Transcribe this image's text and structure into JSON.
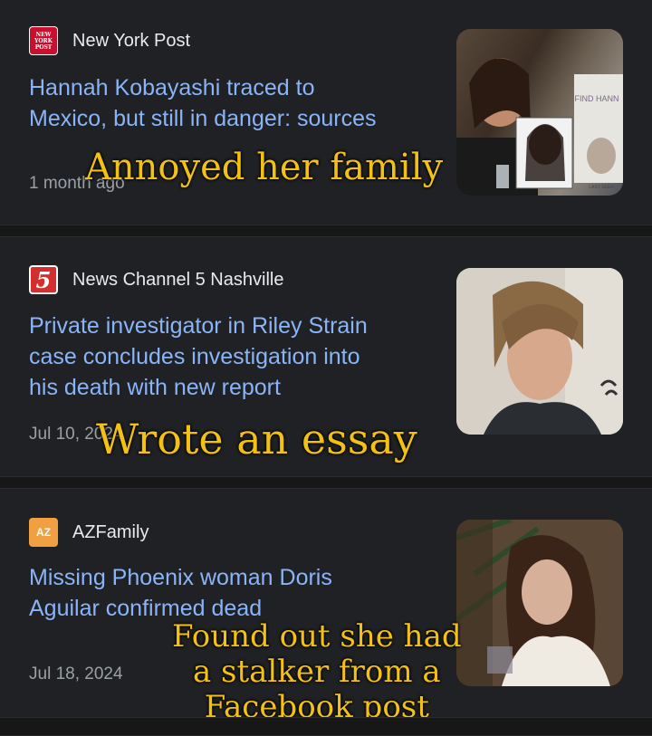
{
  "articles": [
    {
      "source": "New York Post",
      "favicon_text": "NEW YORK POST",
      "headline_lines": [
        "Hannah Kobayashi traced to",
        "Mexico, but still in danger: sources"
      ],
      "date": "1 month ago",
      "thumb_sign": "FIND HANN",
      "thumb_poster": "LAST SEEN"
    },
    {
      "source": "News Channel 5 Nashville",
      "favicon_text": "5",
      "headline_lines": [
        "Private investigator in Riley Strain",
        "case concludes investigation into",
        "his death with new report"
      ],
      "date": "Jul 10, 2024"
    },
    {
      "source": "AZFamily",
      "favicon_text": "AZ",
      "headline_lines": [
        "Missing Phoenix woman Doris",
        "Aguilar confirmed dead"
      ],
      "date": "Jul 18, 2024"
    }
  ],
  "overlays": {
    "caption1": "Annoyed her family",
    "caption2": "Wrote an essay",
    "caption3_lines": [
      "Found out she had",
      "a stalker from a",
      "Facebook post"
    ]
  },
  "colors": {
    "headline": "#8ab4f8",
    "caption": "#f3c014",
    "card_bg": "#202124"
  }
}
